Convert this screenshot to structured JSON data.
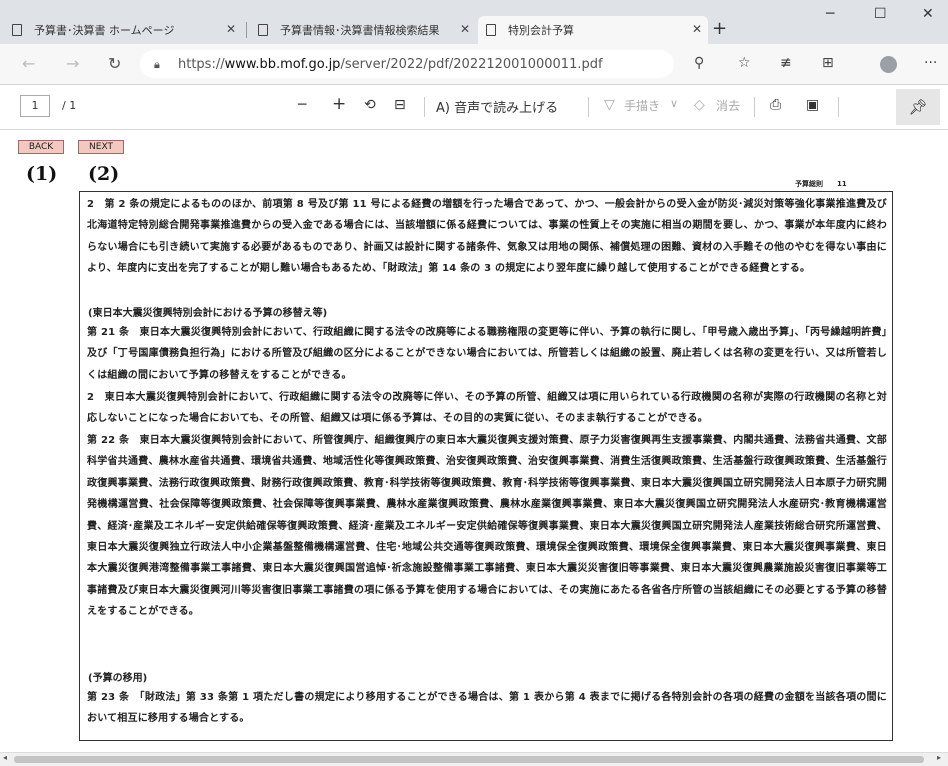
{
  "tabs": [
    {
      "label": "予算書･決算書 ホームページ"
    },
    {
      "label": "予算書情報･決算書情報検索結果"
    },
    {
      "label": "特別会計予算"
    }
  ],
  "address": {
    "url_prefix": "https://",
    "url_host": "www.bb.mof.go.jp",
    "url_path": "/server/2022/pdf/202212001000011.pdf"
  },
  "pdf_toolbar": {
    "page_current": "1",
    "page_total": "/ 1",
    "read_aloud": "A) 音声で読み上げる",
    "draw": "手描き",
    "erase": "消去"
  },
  "nav": {
    "back": "BACK",
    "next": "NEXT",
    "back_num": "(1)",
    "next_num": "(2)"
  },
  "document": {
    "header_right": "予算総則　　11",
    "paragraphs": [
      "2　第 2 条の規定によるもののほか、前項第 8 号及び第 11 号による経費の増額を行った場合であって、かつ、一般会計からの受入金が防災･減災対策等強化事業推進費及び北海道特定特別総合開発事業推進費からの受入金である場合には、当該増額に係る経費については、事業の性質上その実施に相当の期間を要し、かつ、事業が本年度内に終わらない場合にも引き続いて実施する必要があるものであり、計画又は設計に関する諸条件、気象又は用地の関係、補償処理の困難、資材の入手難その他のやむを得ない事由により、年度内に支出を完了することが期し難い場合もあるため、「財政法」第 14 条の 3 の規定により翌年度に繰り越して使用することができる経費とする。",
      "(東日本大震災復興特別会計における予算の移替え等)",
      "第 21 条　東日本大震災復興特別会計において、行政組織に関する法令の改廃等による職務権限の変更等に伴い、予算の執行に関し、「甲号歳入歳出予算」、「丙号繰越明許費」及び「丁号国庫債務負担行為」における所管及び組織の区分によることができない場合においては、所管若しくは組織の設置、廃止若しくは名称の変更を行い、又は所管若しくは組織の間において予算の移替えをすることができる。",
      "2　東日本大震災復興特別会計において、行政組織に関する法令の改廃等に伴い、その予算の所管、組織又は項に用いられている行政機関の名称が実際の行政機関の名称と対応しないことになった場合においても、その所管、組織又は項に係る予算は、その目的の実質に従い、そのまま執行することができる。",
      "第 22 条　東日本大震災復興特別会計において、所管復興庁、組織復興庁の東日本大震災復興支援対策費、原子力災害復興再生支援事業費、内閣共通費、法務省共通費、文部科学省共通費、農林水産省共通費、環境省共通費、地域活性化等復興政策費、治安復興政策費、治安復興事業費、消費生活復興政策費、生活基盤行政復興政策費、生活基盤行政復興事業費、法務行政復興政策費、財務行政復興政策費、教育･科学技術等復興政策費、教育･科学技術等復興事業費、東日本大震災復興国立研究開発法人日本原子力研究開発機構運営費、社会保障等復興政策費、社会保障等復興事業費、農林水産業復興政策費、農林水産業復興事業費、東日本大震災復興国立研究開発法人水産研究･教育機構運営費、経済･産業及エネルギー安定供給確保等復興政策費、経済･産業及エネルギー安定供給確保等復興事業費、東日本大震災復興国立研究開発法人産業技術総合研究所運営費、東日本大震災復興独立行政法人中小企業基盤整備機構運営費、住宅･地域公共交通等復興政策費、環境保全復興政策費、環境保全復興事業費、東日本大震災復興事業費、東日本大震災復興港湾整備事業工事諸費、東日本大震災復興国営追悼･祈念施設整備事業工事諸費、東日本大震災災害復旧等事業費、東日本大震災復興農業施設災害復旧事業等工事諸費及び東日本大震災復興河川等災害復旧事業工事諸費の項に係る予算を使用する場合においては、その実施にあたる各省各庁所管の当該組織にその必要とする予算の移替えをすることができる。",
      "(予算の移用)",
      "第 23 条　「財政法」第 33 条第 1 項ただし書の規定により移用することができる場合は、第 1 表から第 4 表までに掲げる各特別会計の各項の経費の金額を当該各項の間において相互に移用する場合とする。"
    ]
  }
}
